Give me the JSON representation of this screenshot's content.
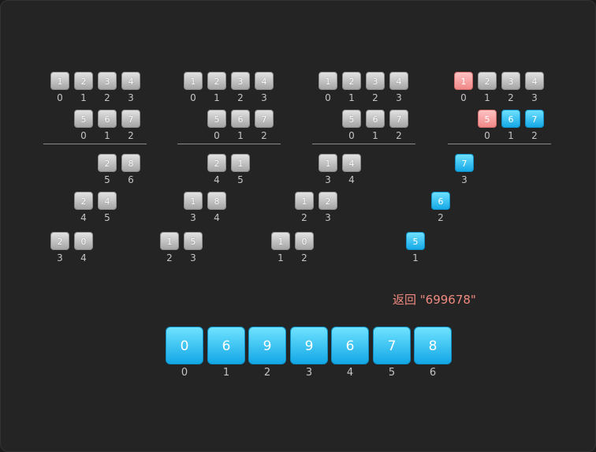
{
  "colors": {
    "background": "#242424",
    "gray_box": "#c4c4c4",
    "blue_box": "#28b8f0",
    "pink_box": "#f5a0a0",
    "label": "#c4c4c4",
    "return_text": "#f08a80"
  },
  "panels": [
    {
      "num1": {
        "boxes": [
          "1",
          "2",
          "3",
          "4"
        ],
        "labels": [
          "0",
          "1",
          "2",
          "3"
        ],
        "states": [
          "gray",
          "gray",
          "gray",
          "gray"
        ]
      },
      "num2": {
        "boxes": [
          "5",
          "6",
          "7"
        ],
        "labels": [
          "0",
          "1",
          "2"
        ],
        "states": [
          "gray",
          "gray",
          "gray"
        ]
      },
      "partials": [
        {
          "boxes": [
            "2",
            "8"
          ],
          "labels": [
            "5",
            "6"
          ],
          "states": [
            "gray",
            "gray"
          ]
        },
        {
          "boxes": [
            "2",
            "4"
          ],
          "labels": [
            "4",
            "5"
          ],
          "states": [
            "gray",
            "gray"
          ]
        },
        {
          "boxes": [
            "2",
            "0"
          ],
          "labels": [
            "3",
            "4"
          ],
          "states": [
            "gray",
            "gray"
          ]
        }
      ]
    },
    {
      "num1": {
        "boxes": [
          "1",
          "2",
          "3",
          "4"
        ],
        "labels": [
          "0",
          "1",
          "2",
          "3"
        ],
        "states": [
          "gray",
          "gray",
          "gray",
          "gray"
        ]
      },
      "num2": {
        "boxes": [
          "5",
          "6",
          "7"
        ],
        "labels": [
          "0",
          "1",
          "2"
        ],
        "states": [
          "gray",
          "gray",
          "gray"
        ]
      },
      "partials": [
        {
          "boxes": [
            "2",
            "1"
          ],
          "labels": [
            "4",
            "5"
          ],
          "states": [
            "gray",
            "gray"
          ]
        },
        {
          "boxes": [
            "1",
            "8"
          ],
          "labels": [
            "3",
            "4"
          ],
          "states": [
            "gray",
            "gray"
          ]
        },
        {
          "boxes": [
            "1",
            "5"
          ],
          "labels": [
            "2",
            "3"
          ],
          "states": [
            "gray",
            "gray"
          ]
        }
      ]
    },
    {
      "num1": {
        "boxes": [
          "1",
          "2",
          "3",
          "4"
        ],
        "labels": [
          "0",
          "1",
          "2",
          "3"
        ],
        "states": [
          "gray",
          "gray",
          "gray",
          "gray"
        ]
      },
      "num2": {
        "boxes": [
          "5",
          "6",
          "7"
        ],
        "labels": [
          "0",
          "1",
          "2"
        ],
        "states": [
          "gray",
          "gray",
          "gray"
        ]
      },
      "partials": [
        {
          "boxes": [
            "1",
            "4"
          ],
          "labels": [
            "3",
            "4"
          ],
          "states": [
            "gray",
            "gray"
          ]
        },
        {
          "boxes": [
            "1",
            "2"
          ],
          "labels": [
            "2",
            "3"
          ],
          "states": [
            "gray",
            "gray"
          ]
        },
        {
          "boxes": [
            "1",
            "0"
          ],
          "labels": [
            "1",
            "2"
          ],
          "states": [
            "gray",
            "gray"
          ]
        }
      ]
    },
    {
      "num1": {
        "boxes": [
          "1",
          "2",
          "3",
          "4"
        ],
        "labels": [
          "0",
          "1",
          "2",
          "3"
        ],
        "states": [
          "pink",
          "gray",
          "gray",
          "gray"
        ]
      },
      "num2": {
        "boxes": [
          "5",
          "6",
          "7"
        ],
        "labels": [
          "0",
          "1",
          "2"
        ],
        "states": [
          "pink",
          "blue",
          "blue"
        ]
      },
      "partials": [
        {
          "boxes": [
            "7"
          ],
          "labels": [
            "3"
          ],
          "states": [
            "blue"
          ]
        },
        {
          "boxes": [
            "6"
          ],
          "labels": [
            "2"
          ],
          "states": [
            "blue"
          ]
        },
        {
          "boxes": [
            "5"
          ],
          "labels": [
            "1"
          ],
          "states": [
            "blue"
          ]
        }
      ]
    }
  ],
  "return_text": "返回 \"699678\"",
  "result": {
    "digits": [
      "0",
      "6",
      "9",
      "9",
      "6",
      "7",
      "8"
    ],
    "indices": [
      "0",
      "1",
      "2",
      "3",
      "4",
      "5",
      "6"
    ]
  }
}
